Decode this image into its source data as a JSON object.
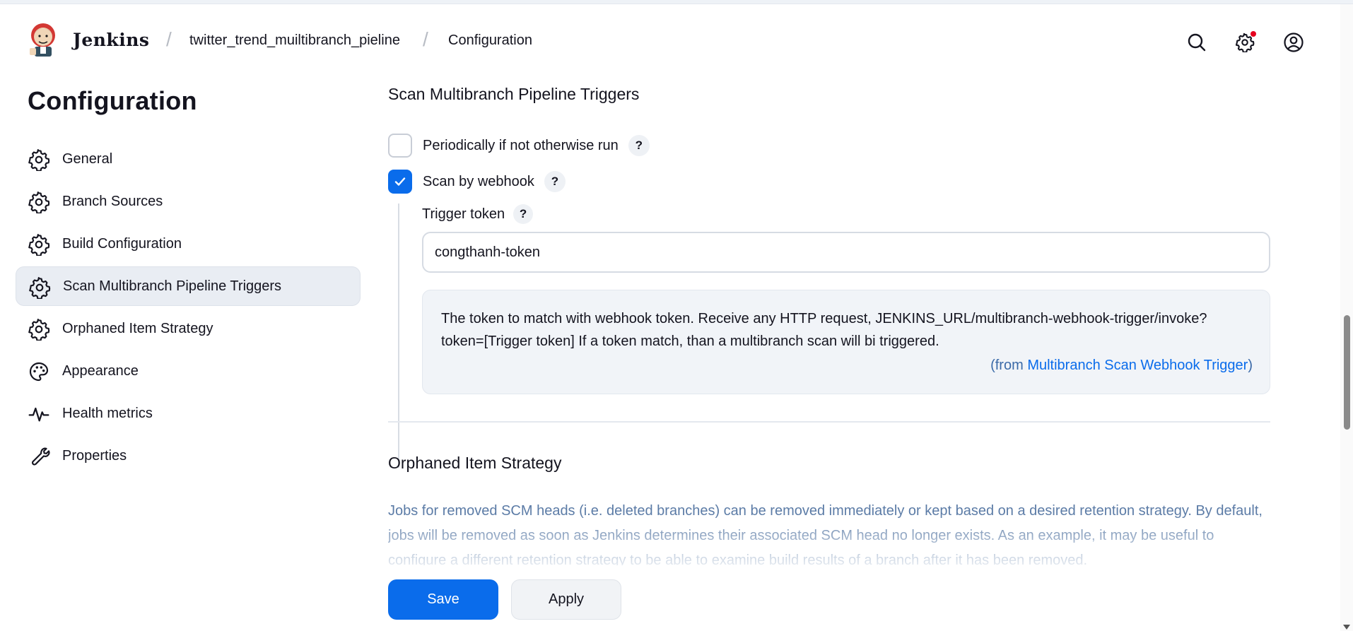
{
  "header": {
    "brand": "Jenkins",
    "breadcrumbs": [
      "twitter_trend_muiltibranch_pieline",
      "Configuration"
    ],
    "separator": "/"
  },
  "sidebar": {
    "title": "Configuration",
    "items": [
      {
        "label": "General",
        "icon": "gear-icon",
        "active": false
      },
      {
        "label": "Branch Sources",
        "icon": "gear-icon",
        "active": false
      },
      {
        "label": "Build Configuration",
        "icon": "gear-icon",
        "active": false
      },
      {
        "label": "Scan Multibranch Pipeline Triggers",
        "icon": "gear-icon",
        "active": true
      },
      {
        "label": "Orphaned Item Strategy",
        "icon": "gear-icon",
        "active": false
      },
      {
        "label": "Appearance",
        "icon": "palette-icon",
        "active": false
      },
      {
        "label": "Health metrics",
        "icon": "pulse-icon",
        "active": false
      },
      {
        "label": "Properties",
        "icon": "wrench-icon",
        "active": false
      }
    ]
  },
  "main": {
    "triggers": {
      "title": "Scan Multibranch Pipeline Triggers",
      "periodic_label": "Periodically if not otherwise run",
      "periodic_checked": false,
      "webhook_label": "Scan by webhook",
      "webhook_checked": true,
      "token_label": "Trigger token",
      "token_value": "congthanh-token",
      "help_line1": "The token to match with webhook token. Receive any HTTP request, JENKINS_URL/multibranch-webhook-trigger/invoke?",
      "help_line2": "token=[Trigger token] If a token match, than a multibranch scan will bi triggered.",
      "help_from_prefix": "(from ",
      "help_from_link": "Multibranch Scan Webhook Trigger",
      "help_from_suffix": ")",
      "help_button": "?"
    },
    "orphaned": {
      "title": "Orphaned Item Strategy",
      "description": "Jobs for removed SCM heads (i.e. deleted branches) can be removed immediately or kept based on a desired retention strategy. By default, jobs will be removed as soon as Jenkins determines their associated SCM head no longer exists. As an example, it may be useful to configure a different retention strategy to be able to examine build results of a branch after it has been removed."
    }
  },
  "actions": {
    "save_label": "Save",
    "apply_label": "Apply"
  },
  "colors": {
    "accent": "#0a6ceb",
    "active_bg": "#e9edf3",
    "notification": "#e6001f"
  }
}
